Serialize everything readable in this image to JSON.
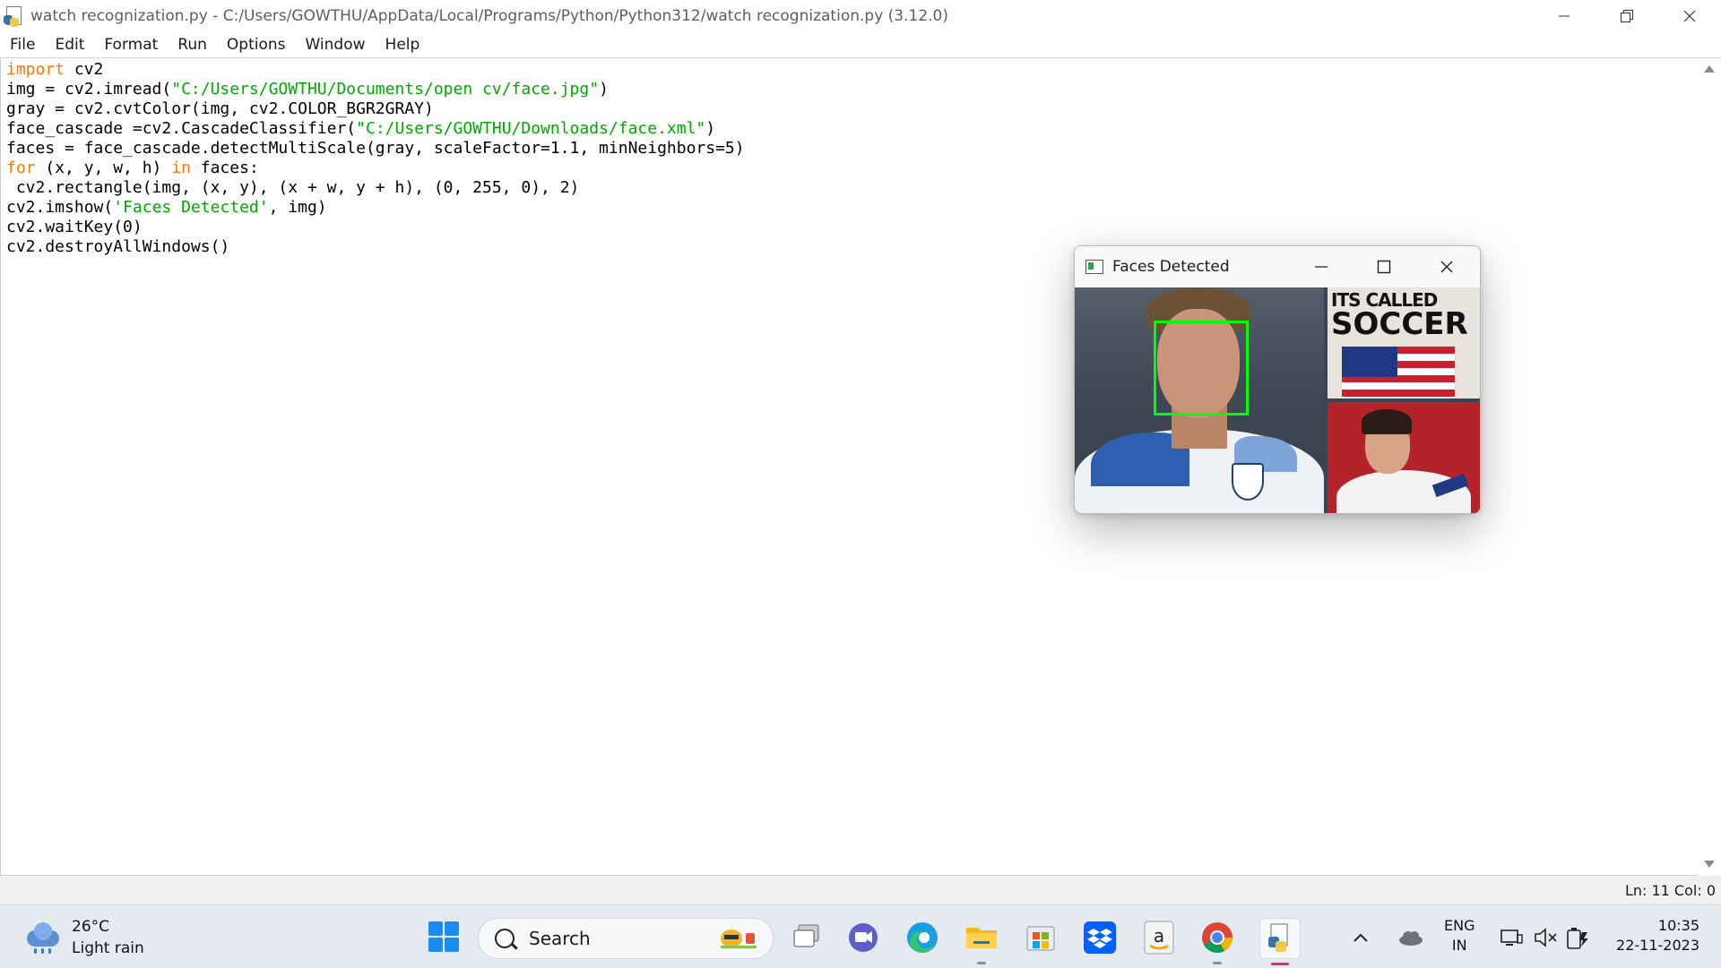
{
  "window": {
    "title": "watch recognization.py - C:/Users/GOWTHU/AppData/Local/Programs/Python/Python312/watch recognization.py (3.12.0)"
  },
  "menu": [
    "File",
    "Edit",
    "Format",
    "Run",
    "Options",
    "Window",
    "Help"
  ],
  "code": {
    "line1_kw": "import",
    "line1_rest": " cv2",
    "line2_pre": "img = cv2.imread(",
    "line2_str": "\"C:/Users/GOWTHU/Documents/open cv/face.jpg\"",
    "line2_post": ")",
    "line3": "gray = cv2.cvtColor(img, cv2.COLOR_BGR2GRAY)",
    "line4_pre": "face_cascade =cv2.CascadeClassifier(",
    "line4_str": "\"C:/Users/GOWTHU/Downloads/face.xml\"",
    "line4_post": ")",
    "line5": "faces = face_cascade.detectMultiScale(gray, scaleFactor=1.1, minNeighbors=5)",
    "line6_kw1": "for",
    "line6_mid": " (x, y, w, h) ",
    "line6_kw2": "in",
    "line6_post": " faces:",
    "line7": " cv2.rectangle(img, (x, y), (x + w, y + h), (0, 255, 0), 2)",
    "line8_pre": "cv2.imshow(",
    "line8_str": "'Faces Detected'",
    "line8_post": ", img)",
    "line9": "cv2.waitKey(0)",
    "line10": "cv2.destroyAllWindows()"
  },
  "status": {
    "position": "Ln: 11   Col: 0"
  },
  "popup": {
    "title": "Faces Detected",
    "image_banner_line1": "ITS CALLED",
    "image_banner_line2": "SOCCER"
  },
  "colors": {
    "keyword": "#ff7700",
    "string": "#00aa00",
    "detection_box": "#00ff00"
  },
  "taskbar": {
    "weather_temp": "26°C",
    "weather_desc": "Light rain",
    "search_label": "Search",
    "lang_line1": "ENG",
    "lang_line2": "IN",
    "time": "10:35",
    "date": "22-11-2023"
  }
}
